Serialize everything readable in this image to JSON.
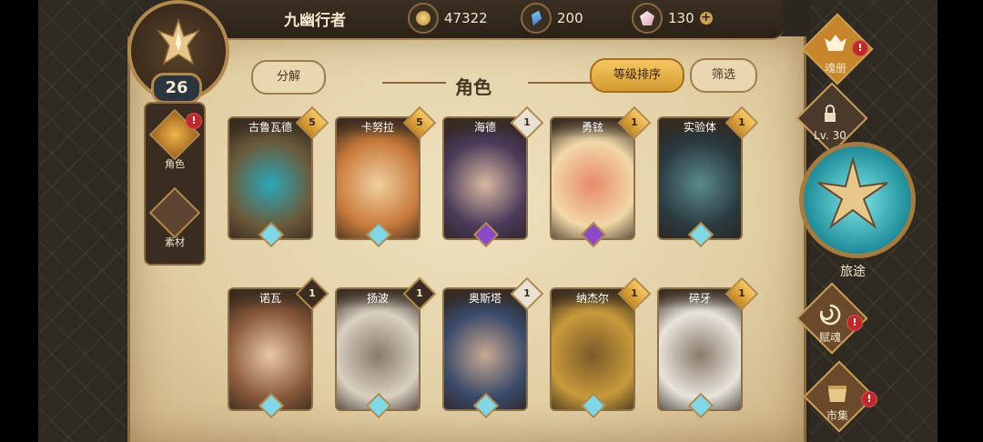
{
  "player": {
    "name": "九幽行者",
    "level": "26"
  },
  "resources": {
    "gold": "47322",
    "gems": "200",
    "crystals": "130"
  },
  "colors": {
    "accent_gold": "#f6c862",
    "parchment": "#e8d7b0",
    "frame": "#8e7048",
    "alert_red": "#c2282a"
  },
  "side_tabs": [
    {
      "label": "角色",
      "icon": "hero-crest-icon",
      "active": true,
      "alert": "!"
    },
    {
      "label": "素材",
      "icon": "material-icon",
      "active": false
    }
  ],
  "toolbar": {
    "disassemble": "分解",
    "title": "角色",
    "sort": "等级排序",
    "filter": "筛选"
  },
  "cards": [
    {
      "name": "古鲁瓦德",
      "stars": "5",
      "star_style": "gold",
      "colors": [
        "#6b5a3a",
        "#2aa7b8"
      ]
    },
    {
      "name": "卡努拉",
      "stars": "5",
      "star_style": "gold",
      "colors": [
        "#c87a3a",
        "#f0d0a0"
      ]
    },
    {
      "name": "海德",
      "stars": "1",
      "star_style": "silver",
      "colors": [
        "#4a3a5a",
        "#d8b8a0"
      ]
    },
    {
      "name": "勇铉",
      "stars": "1",
      "star_style": "gold",
      "colors": [
        "#f2d8a8",
        "#e88a6a"
      ]
    },
    {
      "name": "实验体",
      "stars": "1",
      "star_style": "gold",
      "colors": [
        "#2a3a40",
        "#5a8a8a"
      ]
    },
    {
      "name": "诺瓦",
      "stars": "1",
      "star_style": "dark",
      "colors": [
        "#8a5a3a",
        "#e8c8a8"
      ]
    },
    {
      "name": "扬波",
      "stars": "1",
      "star_style": "dark",
      "colors": [
        "#d8d0c0",
        "#8a7a6a"
      ]
    },
    {
      "name": "奥斯塔",
      "stars": "1",
      "star_style": "silver",
      "colors": [
        "#3a4a6a",
        "#c8a890"
      ]
    },
    {
      "name": "纳杰尔",
      "stars": "1",
      "star_style": "gold",
      "colors": [
        "#c89a3a",
        "#7a5a2a"
      ]
    },
    {
      "name": "碎牙",
      "stars": "1",
      "star_style": "gold",
      "colors": [
        "#e8e4dc",
        "#8a7a6a"
      ]
    }
  ],
  "right_menu": {
    "soul_book": {
      "label": "魂册",
      "icon": "soul-book-icon"
    },
    "locked": {
      "label": "Lv. 30",
      "icon": "lock-icon"
    },
    "journey": {
      "label": "旅途",
      "icon": "compass-emblem-icon"
    },
    "soul_gift": {
      "label": "赋魂",
      "icon": "swirl-icon"
    },
    "market": {
      "label": "市集",
      "icon": "market-icon"
    }
  },
  "alert_mark": "!"
}
